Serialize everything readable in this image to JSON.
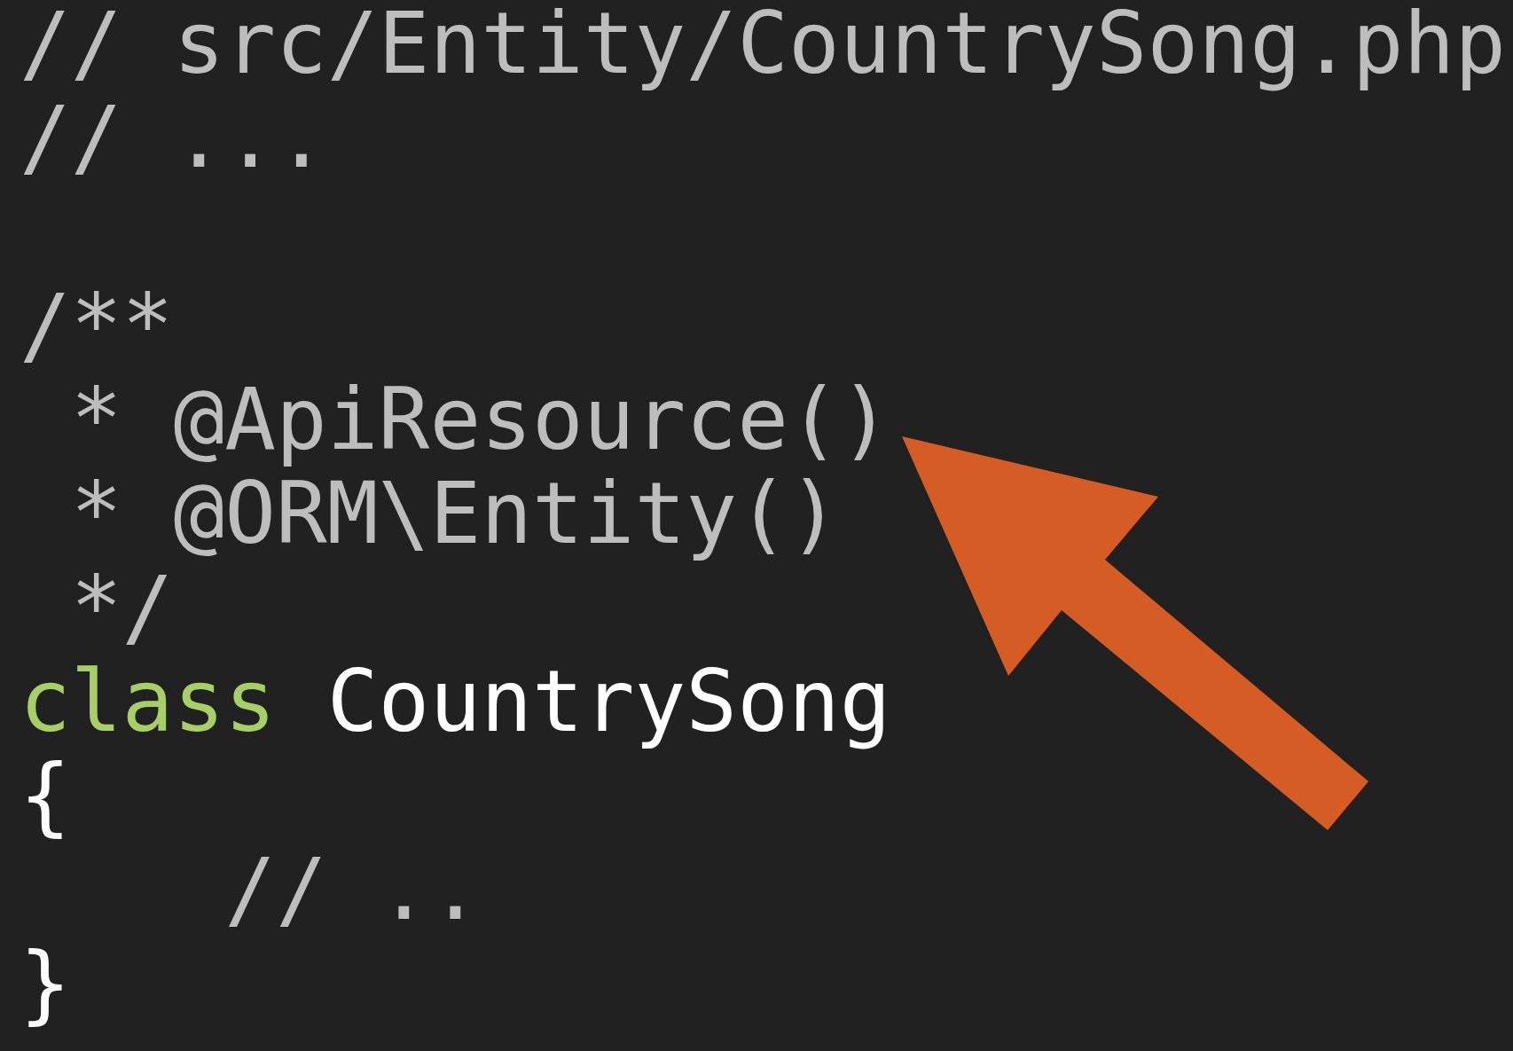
{
  "code_blocks": [
    {
      "lines": [
        {
          "tokens": [
            {
              "text": "// src/Entity/CountrySong.php",
              "kind": "comment"
            }
          ]
        },
        {
          "tokens": [
            {
              "text": "// ...",
              "kind": "comment"
            }
          ]
        }
      ]
    },
    {
      "lines": [
        {
          "tokens": [
            {
              "text": "/**",
              "kind": "comment"
            }
          ]
        },
        {
          "tokens": [
            {
              "text": " * @ApiResource()",
              "kind": "comment"
            }
          ]
        },
        {
          "tokens": [
            {
              "text": " * @ORM\\Entity()",
              "kind": "comment"
            }
          ]
        },
        {
          "tokens": [
            {
              "text": " */",
              "kind": "comment"
            }
          ]
        },
        {
          "tokens": [
            {
              "text": "class",
              "kind": "keyword"
            },
            {
              "text": " CountrySong",
              "kind": "plain"
            }
          ]
        },
        {
          "tokens": [
            {
              "text": "{",
              "kind": "plain"
            }
          ]
        },
        {
          "tokens": [
            {
              "text": "    // ..",
              "kind": "comment"
            }
          ]
        },
        {
          "tokens": [
            {
              "text": "}",
              "kind": "plain"
            }
          ]
        }
      ]
    }
  ]
}
